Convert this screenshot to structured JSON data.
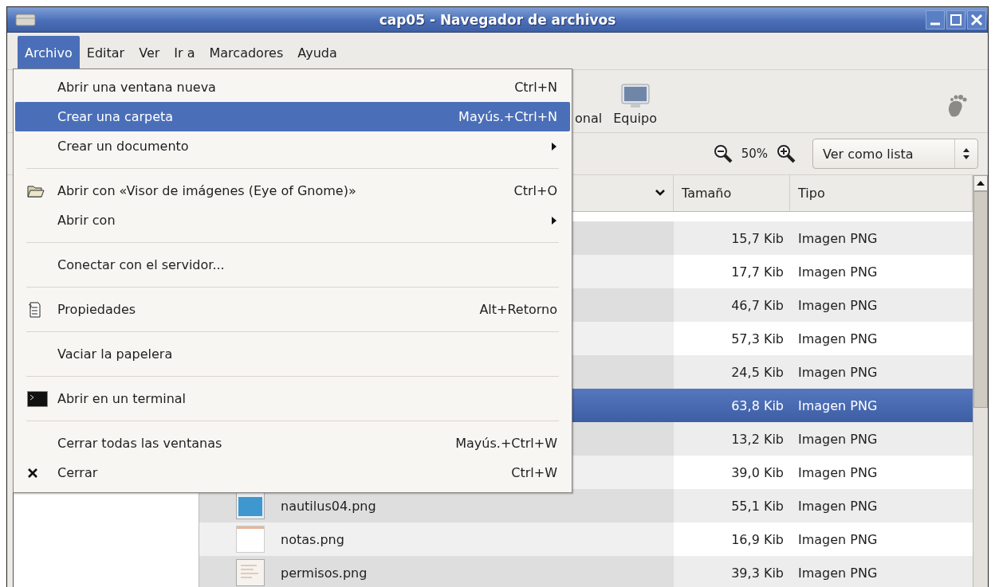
{
  "window": {
    "title": "cap05 - Navegador de archivos"
  },
  "menubar": [
    {
      "label": "Archivo",
      "selected": true
    },
    {
      "label": "Editar",
      "selected": false
    },
    {
      "label": "Ver",
      "selected": false
    },
    {
      "label": "Ir a",
      "selected": false
    },
    {
      "label": "Marcadores",
      "selected": false
    },
    {
      "label": "Ayuda",
      "selected": false
    }
  ],
  "menu": [
    {
      "kind": "plain",
      "label": "Abrir una ventana nueva",
      "shortcut": "Ctrl+N",
      "selected": false
    },
    {
      "kind": "plain",
      "label": "Crear una carpeta",
      "shortcut": "Mayús.+Ctrl+N",
      "selected": true
    },
    {
      "kind": "submenu",
      "label": "Crear un documento",
      "selected": false
    },
    {
      "kind": "separator"
    },
    {
      "kind": "folder",
      "label": "Abrir con «Visor de imágenes (Eye of Gnome)»",
      "shortcut": "Ctrl+O",
      "selected": false
    },
    {
      "kind": "submenu",
      "label": "Abrir con",
      "selected": false
    },
    {
      "kind": "separator"
    },
    {
      "kind": "plain",
      "label": "Conectar con el servidor...",
      "selected": false
    },
    {
      "kind": "separator"
    },
    {
      "kind": "properties",
      "label": "Propiedades",
      "shortcut": "Alt+Retorno",
      "selected": false
    },
    {
      "kind": "separator"
    },
    {
      "kind": "plain",
      "label": "Vaciar la papelera",
      "selected": false
    },
    {
      "kind": "separator"
    },
    {
      "kind": "terminal",
      "label": "Abrir en un terminal",
      "selected": false
    },
    {
      "kind": "separator"
    },
    {
      "kind": "plain",
      "label": "Cerrar todas las ventanas",
      "shortcut": "Mayús.+Ctrl+W",
      "selected": false
    },
    {
      "kind": "close",
      "label": "Cerrar",
      "shortcut": "Ctrl+W",
      "selected": false
    }
  ],
  "toolbar": [
    {
      "kind": "label",
      "label": "onal"
    },
    {
      "kind": "computer",
      "label": "Equipo"
    }
  ],
  "zoom": {
    "value": "50%"
  },
  "view_select": {
    "value": "Ver como lista"
  },
  "columns": [
    {
      "label": "Tamaño"
    },
    {
      "label": "Tipo"
    }
  ],
  "rows": [
    {
      "size": "15,7 Kib",
      "type": "Imagen PNG",
      "selected": false
    },
    {
      "size": "17,7 Kib",
      "type": "Imagen PNG",
      "selected": false
    },
    {
      "size": "46,7 Kib",
      "type": "Imagen PNG",
      "selected": false
    },
    {
      "size": "57,3 Kib",
      "type": "Imagen PNG",
      "selected": false
    },
    {
      "size": "24,5 Kib",
      "type": "Imagen PNG",
      "selected": false
    },
    {
      "size": "63,8 Kib",
      "type": "Imagen PNG",
      "selected": true
    },
    {
      "size": "13,2 Kib",
      "type": "Imagen PNG",
      "selected": false
    },
    {
      "size": "39,0 Kib",
      "type": "Imagen PNG",
      "selected": false
    },
    {
      "name": "nautilus04.png",
      "kind": "window",
      "size": "55,1 Kib",
      "type": "Imagen PNG",
      "selected": false
    },
    {
      "name": "notas.png",
      "kind": "blank",
      "size": "16,9 Kib",
      "type": "Imagen PNG",
      "selected": false
    },
    {
      "name": "permisos.png",
      "kind": "document",
      "size": "39,3 Kib",
      "type": "Imagen PNG",
      "selected": false
    }
  ]
}
